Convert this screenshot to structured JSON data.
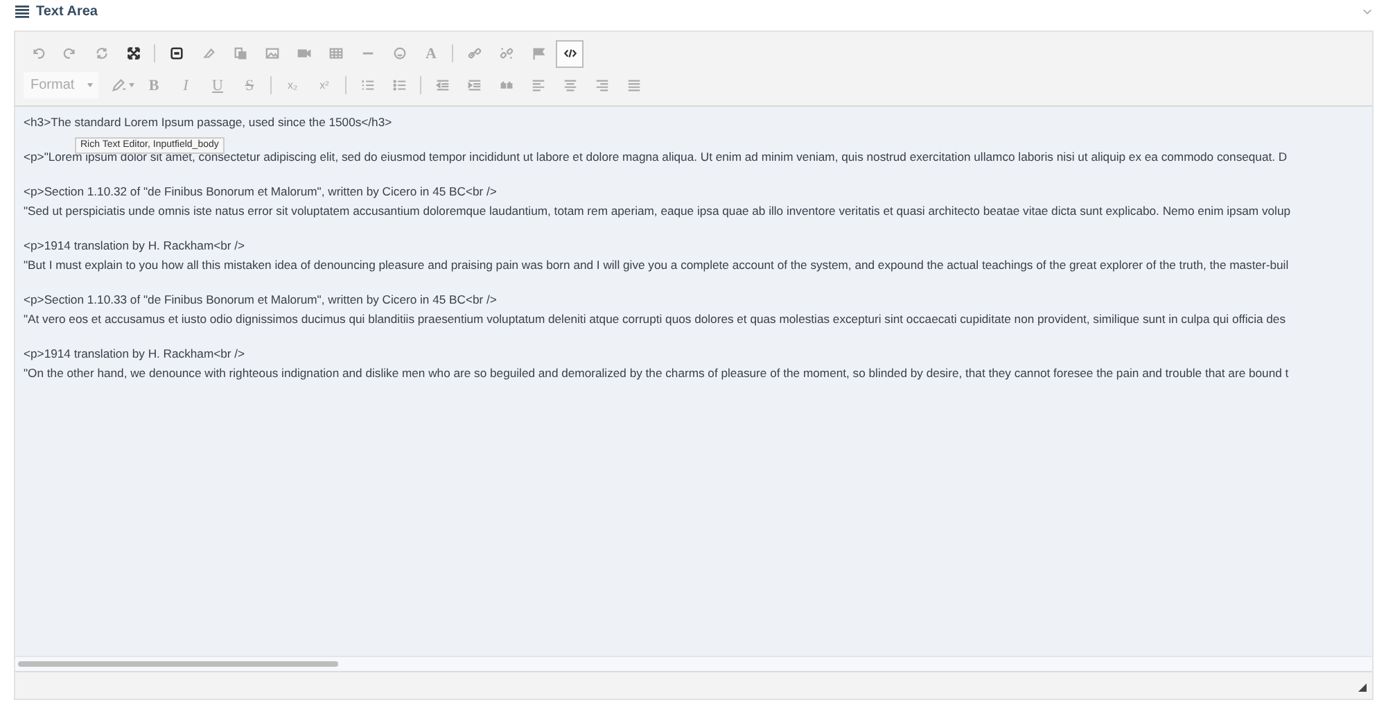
{
  "panel": {
    "title": "Text Area",
    "expanded": true
  },
  "toolbar_rows": [
    [
      {
        "kind": "undo",
        "disabled": true,
        "selected": false
      },
      {
        "kind": "redo",
        "disabled": true,
        "selected": false
      },
      {
        "kind": "refresh",
        "disabled": true,
        "selected": false
      },
      {
        "kind": "maximize",
        "disabled": false,
        "selected": false
      },
      {
        "kind": "separator"
      },
      {
        "kind": "block",
        "disabled": false,
        "selected": false
      },
      {
        "kind": "eraser",
        "disabled": true,
        "selected": false
      },
      {
        "kind": "paste",
        "disabled": true,
        "selected": false
      },
      {
        "kind": "image",
        "disabled": true,
        "selected": false
      },
      {
        "kind": "video",
        "disabled": true,
        "selected": false
      },
      {
        "kind": "table",
        "disabled": true,
        "selected": false
      },
      {
        "kind": "rule",
        "disabled": true,
        "selected": false
      },
      {
        "kind": "smiley",
        "disabled": true,
        "selected": false
      },
      {
        "kind": "letter",
        "label": "A",
        "disabled": true,
        "selected": false
      },
      {
        "kind": "separator"
      },
      {
        "kind": "link",
        "disabled": true,
        "selected": false
      },
      {
        "kind": "unlink",
        "disabled": true,
        "selected": false
      },
      {
        "kind": "flag",
        "disabled": true,
        "selected": false
      },
      {
        "kind": "code",
        "disabled": false,
        "selected": true
      }
    ],
    [
      {
        "kind": "dropdown",
        "label": "Format",
        "disabled": true,
        "selected": false
      },
      {
        "kind": "pen",
        "disabled": true,
        "selected": false
      },
      {
        "kind": "letter",
        "label": "B",
        "disabled": true,
        "selected": false
      },
      {
        "kind": "letter",
        "label": "I",
        "disabled": true,
        "selected": false
      },
      {
        "kind": "letter",
        "label": "U",
        "disabled": true,
        "selected": false
      },
      {
        "kind": "letter",
        "label": "S",
        "disabled": true,
        "selected": false
      },
      {
        "kind": "separator"
      },
      {
        "kind": "script",
        "label": "x₂",
        "disabled": true,
        "selected": false
      },
      {
        "kind": "script",
        "label": "x²",
        "disabled": true,
        "selected": false
      },
      {
        "kind": "separator"
      },
      {
        "kind": "numbered",
        "disabled": true,
        "selected": false
      },
      {
        "kind": "bulleted",
        "disabled": true,
        "selected": false
      },
      {
        "kind": "separator"
      },
      {
        "kind": "outdent",
        "disabled": true,
        "selected": false
      },
      {
        "kind": "indent",
        "disabled": true,
        "selected": false
      },
      {
        "kind": "quote",
        "disabled": true,
        "selected": false
      },
      {
        "kind": "left",
        "disabled": true,
        "selected": false
      },
      {
        "kind": "center",
        "disabled": true,
        "selected": false
      },
      {
        "kind": "right",
        "disabled": true,
        "selected": false
      },
      {
        "kind": "justify",
        "disabled": true,
        "selected": false
      }
    ]
  ],
  "source_paragraphs": [
    [
      "<h3>The standard Lorem Ipsum passage, used since the 1500s</h3>"
    ],
    [
      "<p>\"Lorem ipsum dolor sit amet, consectetur adipiscing elit, sed do eiusmod tempor incididunt ut labore et dolore magna aliqua. Ut enim ad minim veniam, quis nostrud exercitation ullamco laboris nisi ut aliquip ex ea commodo consequat. D"
    ],
    [
      "<p>Section 1.10.32 of \"de Finibus Bonorum et Malorum\", written by Cicero in 45 BC<br />",
      "\"Sed ut perspiciatis unde omnis iste natus error sit voluptatem accusantium doloremque laudantium, totam rem aperiam, eaque ipsa quae ab illo inventore veritatis et quasi architecto beatae vitae dicta sunt explicabo. Nemo enim ipsam volup"
    ],
    [
      "<p>1914 translation by H. Rackham<br />",
      "\"But I must explain to you how all this mistaken idea of denouncing pleasure and praising pain was born and I will give you a complete account of the system, and expound the actual teachings of the great explorer of the truth, the master-buil"
    ],
    [
      "<p>Section 1.10.33 of \"de Finibus Bonorum et Malorum\", written by Cicero in 45 BC<br />",
      "\"At vero eos et accusamus et iusto odio dignissimos ducimus qui blanditiis praesentium voluptatum deleniti atque corrupti quos dolores et quas molestias excepturi sint occaecati cupiditate non provident, similique sunt in culpa qui officia des"
    ],
    [
      "<p>1914 translation by H. Rackham<br />",
      "\"On the other hand, we denounce with righteous indignation and dislike men who are so beguiled and demoralized by the charms of pleasure of the moment, so blinded by desire, that they cannot foresee the pain and trouble that are bound t"
    ]
  ],
  "tooltip": "Rich Text Editor, Inputfield_body"
}
